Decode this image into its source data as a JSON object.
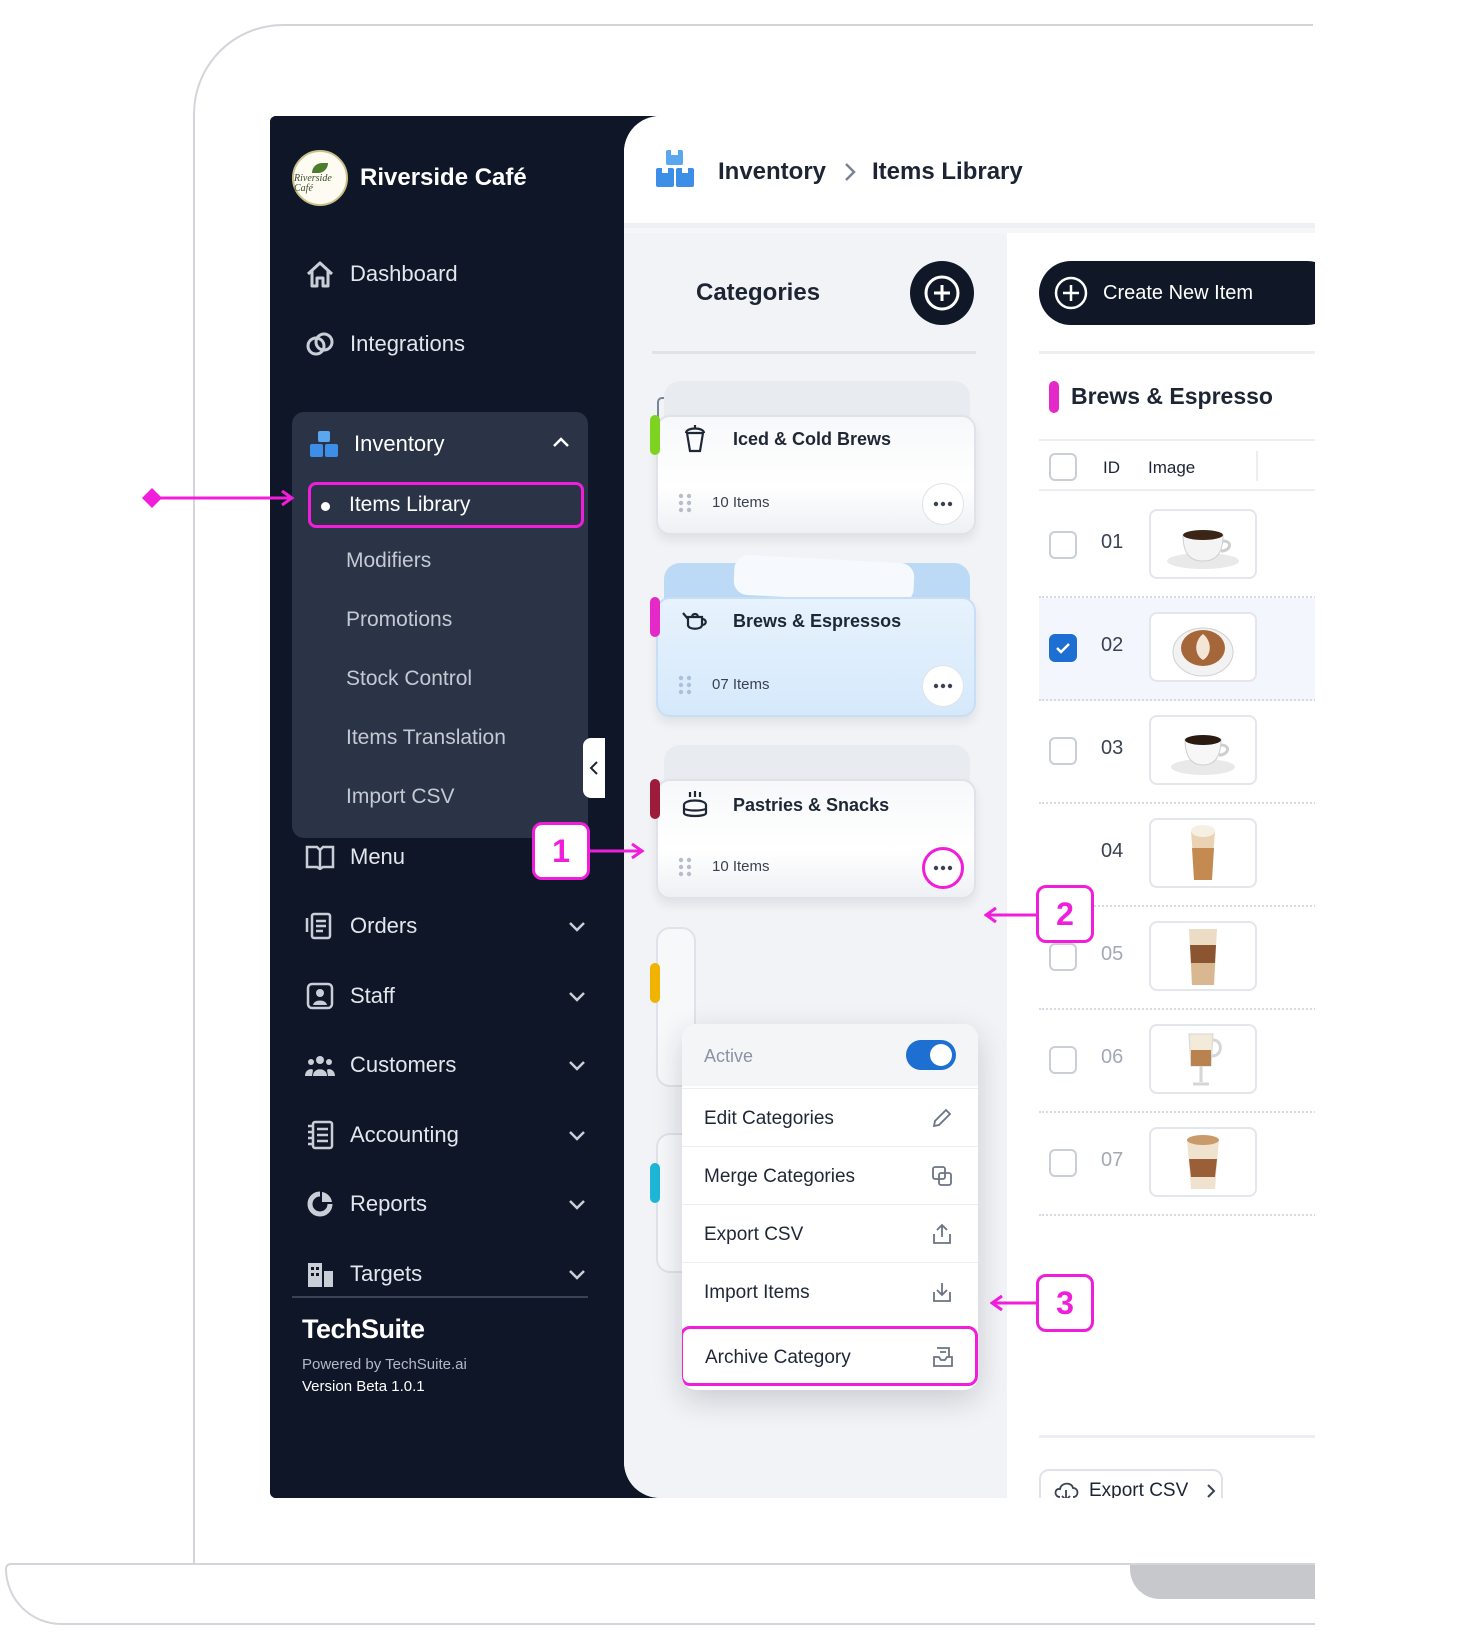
{
  "brand": {
    "name": "Riverside Café",
    "logo_text": "Riverside Café"
  },
  "sidebar": {
    "nav": [
      {
        "label": "Dashboard",
        "icon": "home-icon"
      },
      {
        "label": "Integrations",
        "icon": "link-icon"
      }
    ],
    "inventory": {
      "label": "Inventory",
      "sub_items": [
        "Items Library",
        "Modifiers",
        "Promotions",
        "Stock Control",
        "Items Translation",
        "Import CSV"
      ]
    },
    "nav_more": [
      {
        "label": "Menu",
        "icon": "book-icon"
      },
      {
        "label": "Orders",
        "icon": "receipt-icon"
      },
      {
        "label": "Staff",
        "icon": "user-card-icon"
      },
      {
        "label": "Customers",
        "icon": "people-icon"
      },
      {
        "label": "Accounting",
        "icon": "ledger-icon"
      },
      {
        "label": "Reports",
        "icon": "pie-icon"
      },
      {
        "label": "Targets",
        "icon": "building-icon"
      }
    ],
    "footer": {
      "logo": "TechSuite",
      "powered": "Powered by TechSuite.ai",
      "version": "Version Beta 1.0.1"
    }
  },
  "breadcrumb": {
    "section": "Inventory",
    "page": "Items Library"
  },
  "categories": {
    "title": "Categories",
    "cards": [
      {
        "name": "Iced & Cold Brews",
        "count": "10 Items",
        "color": "#7ed321"
      },
      {
        "name": "Brews & Espressos",
        "count": "07 Items",
        "color": "#e429c8"
      },
      {
        "name": "Pastries & Snacks",
        "count": "10 Items",
        "color": "#9c1c3a"
      }
    ]
  },
  "context_menu": {
    "active_label": "Active",
    "active_on": true,
    "edit": "Edit Categories",
    "merge": "Merge Categories",
    "export": "Export CSV",
    "import": "Import Items",
    "archive": "Archive Category"
  },
  "items": {
    "create_label": "Create New Item",
    "group_title": "Brews & Espresso",
    "columns": {
      "id": "ID",
      "image": "Image"
    },
    "rows": [
      {
        "id": "01",
        "checked": false
      },
      {
        "id": "02",
        "checked": true
      },
      {
        "id": "03",
        "checked": false
      },
      {
        "id": "04",
        "checked": false
      },
      {
        "id": "05",
        "checked": false
      },
      {
        "id": "06",
        "checked": false
      },
      {
        "id": "07",
        "checked": false
      }
    ],
    "export_label": "Export CSV"
  },
  "callouts": {
    "one": "1",
    "two": "2",
    "three": "3"
  },
  "colors": {
    "accent": "#f01ddb",
    "primary": "#1d6fd1",
    "sidebar": "#0e1627"
  }
}
